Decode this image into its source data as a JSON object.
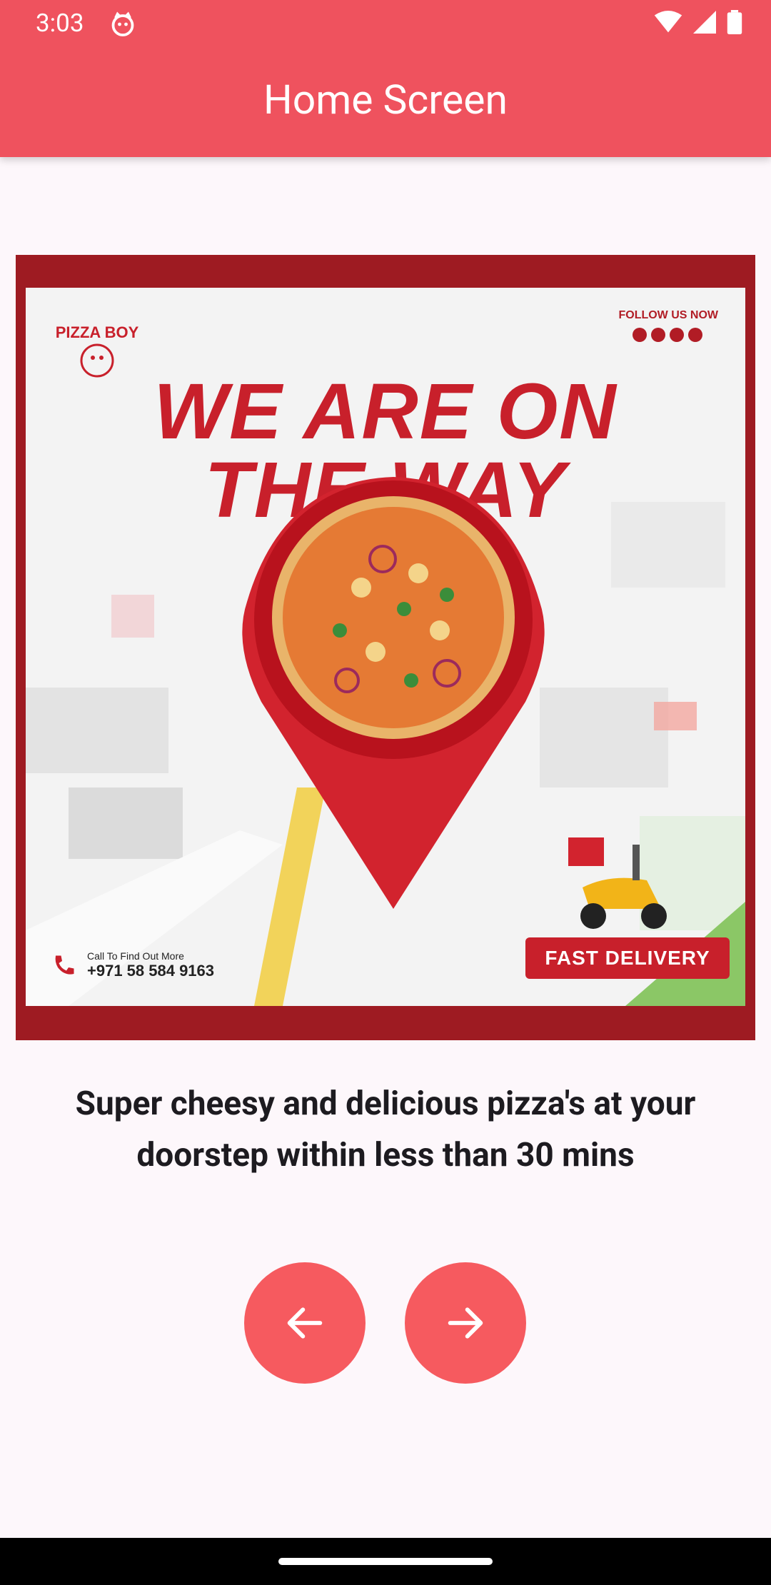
{
  "status_bar": {
    "time": "3:03"
  },
  "app_bar": {
    "title": "Home Screen"
  },
  "banner": {
    "headline_line1": "WE ARE ON",
    "headline_line2": "THE WAY",
    "follow_label": "FOLLOW US NOW",
    "call_label": "Call To Find Out More",
    "phone": "+971 58 584 9163",
    "badge": "FAST DELIVERY",
    "brand": "PIZZA BOY"
  },
  "caption": {
    "text": "Super cheesy and delicious pizza's at your doorstep within less than 30 mins"
  },
  "buttons": {
    "prev_icon": "arrow-left-icon",
    "next_icon": "arrow-right-icon"
  },
  "colors": {
    "app_bar": "#ef525e",
    "button": "#f65a5f",
    "background": "#fdf7fb",
    "banner_red": "#c8202b"
  }
}
